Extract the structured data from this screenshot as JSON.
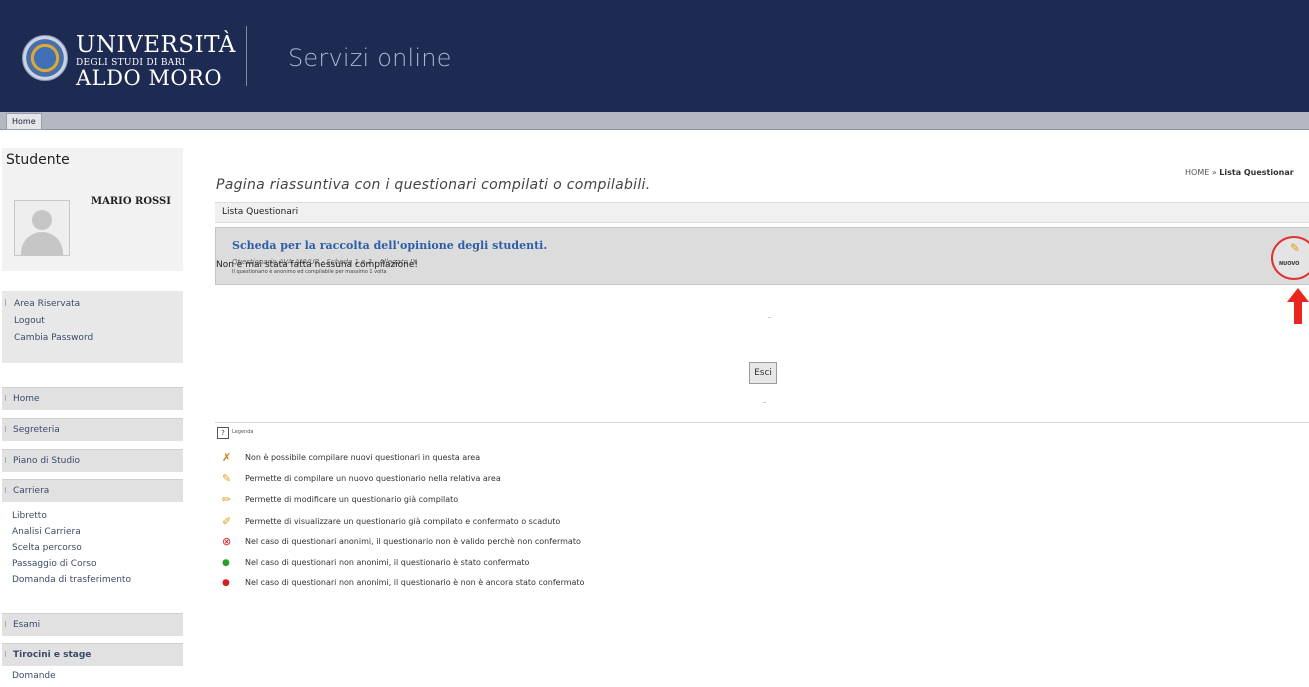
{
  "header": {
    "logo_line1": "UNIVERSITÀ",
    "logo_line2": "DEGLI STUDI DI BARI",
    "logo_line3": "ALDO MORO",
    "site_title": "Servizi online"
  },
  "topnav": {
    "home_tab": "Home"
  },
  "sidebar": {
    "section_title": "Studente",
    "student_name": "MARIO ROSSI",
    "reserved_area": [
      "Area Riservata",
      "Logout",
      "Cambia Password"
    ],
    "menu": [
      {
        "label": "Home"
      },
      {
        "label": "Segreteria"
      },
      {
        "label": "Piano di Studio"
      },
      {
        "label": "Carriera",
        "sub": [
          "Libretto",
          "Analisi Carriera",
          "Scelta percorso",
          "Passaggio di Corso",
          "Domanda di trasferimento"
        ]
      },
      {
        "label": "Esami"
      },
      {
        "label": "Tirocini e stage",
        "sub": [
          "Domande"
        ]
      }
    ]
  },
  "main": {
    "breadcrumb_home": "HOME",
    "breadcrumb_sep": " » ",
    "breadcrumb_current": "Lista Questionar",
    "heading": "Pagina riassuntiva con i questionari compilati o compilabili.",
    "list_header": "Lista Questionari",
    "card": {
      "title": "Scheda per la raccolta dell'opinione degli studenti.",
      "subtitle": "Questionario AVA ANVUR - Scheda 1 e 3 - Allegato IX",
      "note": "Il questionario è anonimo ed compilabile per massimo 1 volta",
      "new_button": "NUOVO"
    },
    "no_compilation": "Non è mai stata fatta nessuna compilazione!",
    "exit_button": "Esci"
  },
  "legend": {
    "title": "Legenda",
    "items": [
      {
        "icon": "pencil-disabled-icon",
        "color": "#c97d1a",
        "text": "Non è possibile compilare nuovi questionari in questa area"
      },
      {
        "icon": "pencil-new-icon",
        "color": "#d8a21c",
        "text": "Permette di compilare un nuovo questionario nella relativa area"
      },
      {
        "icon": "pencil-edit-icon",
        "color": "#d8a21c",
        "text": "Permette di modificare un questionario già compilato"
      },
      {
        "icon": "pencil-view-icon",
        "color": "#d8a21c",
        "text": "Permette di visualizzare un questionario già compilato e confermato o scaduto"
      },
      {
        "icon": "invalid-circle-icon",
        "color": "#d22020",
        "text": "Nel caso di questionari anonimi, il questionario non è valido perchè non confermato"
      },
      {
        "icon": "green-dot-icon",
        "color": "#2aa02a",
        "text": "Nel caso di questionari non anonimi, il questionario è stato confermato"
      },
      {
        "icon": "red-dot-icon",
        "color": "#d22020",
        "text": "Nel caso di questionari non anonimi, il questionario è non è ancora stato confermato"
      }
    ]
  }
}
